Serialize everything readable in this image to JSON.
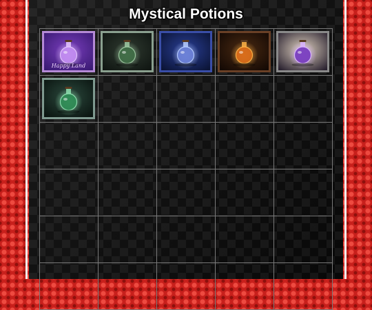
{
  "page": {
    "title": "Mystical Potions"
  },
  "gallery": {
    "columns": 5,
    "rows": 6,
    "items": [
      {
        "icon": "potion-meditation-icon",
        "frame": "#b58ad6",
        "bg1": "#7b3fbf",
        "bg2": "#3a1a73",
        "glow": "#e5c6ff",
        "liquid": "#c08af0",
        "caption": "Happy Land"
      },
      {
        "icon": "potion-heart-bottle-icon",
        "frame": "#8aa08f",
        "bg1": "#2f3a30",
        "bg2": "#101612",
        "glow": "#9fc9a2",
        "liquid": "#3f6b45"
      },
      {
        "icon": "potion-blue-sparkle-icon",
        "frame": "#3a4ea8",
        "bg1": "#2a3f96",
        "bg2": "#0b1436",
        "glow": "#b7ccff",
        "liquid": "#6a7fd6"
      },
      {
        "icon": "potion-fire-bottle-icon",
        "frame": "#6a4026",
        "bg1": "#4a2a12",
        "bg2": "#140904",
        "glow": "#ffb347",
        "liquid": "#d86b1a"
      },
      {
        "icon": "potion-purple-glow-icon",
        "frame": "#8a8a8a",
        "bg1": "#e0d2c0",
        "bg2": "#2a2230",
        "glow": "#d9b3ff",
        "liquid": "#7a3fc0"
      },
      {
        "icon": "potion-green-forest-icon",
        "frame": "#7f9a90",
        "bg1": "#2c4a3e",
        "bg2": "#0a1410",
        "glow": "#8fe0b0",
        "liquid": "#2f8a55"
      }
    ]
  }
}
